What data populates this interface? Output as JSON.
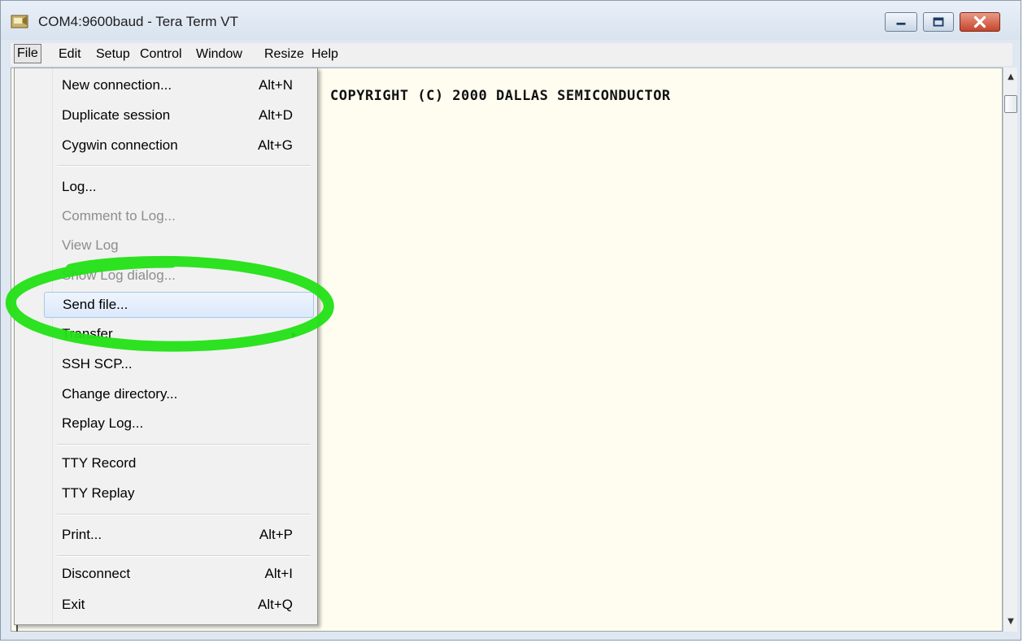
{
  "window": {
    "title": "COM4:9600baud - Tera Term VT",
    "icon": "tera-term-app-icon",
    "controls": {
      "minimize": "minimize-icon",
      "maximize": "maximize-icon",
      "close": "close-icon"
    }
  },
  "menubar": {
    "items": [
      "File",
      "Edit",
      "Setup",
      "Control",
      "Window",
      "Resize",
      "Help"
    ],
    "active": "File"
  },
  "terminal": {
    "lines": [
      "COPYRIGHT (C) 2000 DALLAS SEMICONDUCTOR"
    ],
    "background": "#fffdf0"
  },
  "file_menu": {
    "items": [
      {
        "label": "New connection...",
        "shortcut": "Alt+N"
      },
      {
        "label": "Duplicate session",
        "shortcut": "Alt+D"
      },
      {
        "label": "Cygwin connection",
        "shortcut": "Alt+G"
      },
      {
        "label": "Log..."
      },
      {
        "label": "Comment to Log...",
        "disabled": true
      },
      {
        "label": "View Log",
        "disabled": true
      },
      {
        "label": "Show Log dialog...",
        "disabled": true
      },
      {
        "label": "Send file...",
        "highlighted": true
      },
      {
        "label": "Transfer",
        "submenu": true
      },
      {
        "label": "SSH SCP..."
      },
      {
        "label": "Change directory..."
      },
      {
        "label": "Replay Log..."
      },
      {
        "label": "TTY Record"
      },
      {
        "label": "TTY Replay"
      },
      {
        "label": "Print...",
        "shortcut": "Alt+P"
      },
      {
        "label": "Disconnect",
        "shortcut": "Alt+I"
      },
      {
        "label": "Exit",
        "shortcut": "Alt+Q"
      }
    ]
  },
  "annotation": {
    "shape": "hand-drawn ellipse",
    "color": "#22e014",
    "target": "Send file..."
  }
}
